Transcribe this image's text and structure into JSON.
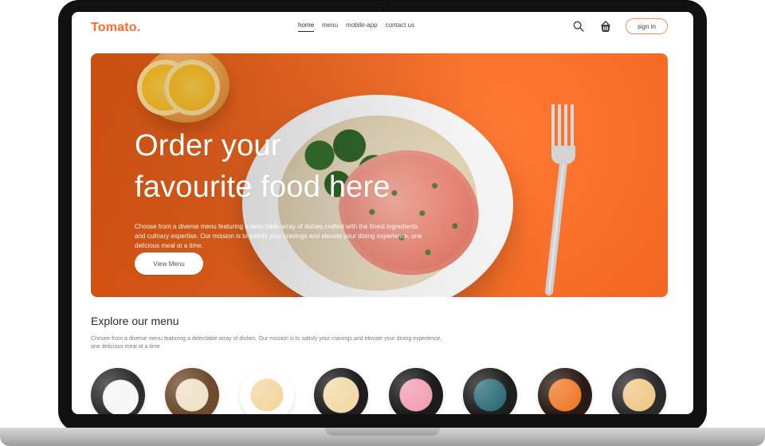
{
  "brand": {
    "logo_text": "Tomato.",
    "accent_color": "#ff6b2c"
  },
  "nav": {
    "items": [
      {
        "label": "home",
        "active": true
      },
      {
        "label": "menu",
        "active": false
      },
      {
        "label": "mobile-app",
        "active": false
      },
      {
        "label": "contact us",
        "active": false
      }
    ],
    "actions": {
      "search_icon": "search-icon",
      "basket_icon": "basket-icon",
      "signin_label": "sign in"
    }
  },
  "hero": {
    "title_line1": "Order your",
    "title_line2": "favourite food here",
    "description": "Choose from a diverse menu featuring a delectable array of dishes crafted with the finest ingredients and culinary expertise. Our mission is to satisfy your cravings and elevate your dining experience, one delicious meal at a time.",
    "button_label": "View Menu"
  },
  "explore": {
    "title": "Explore our menu",
    "description": "Chosee from a diverse menu featuring a delectable array of dishes. Our mission is to satisfy your cravings and elevate your dining experience, one delicious meal at a time"
  }
}
